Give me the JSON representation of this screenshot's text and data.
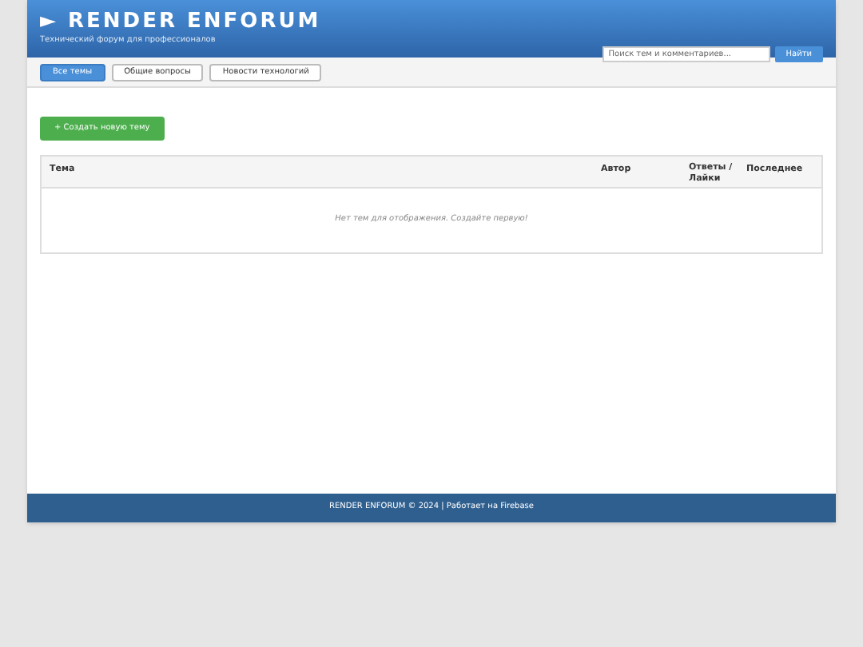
{
  "header": {
    "title": "► RENDER ENFORUM",
    "subtitle": "Технический форум для профессионалов",
    "search": {
      "placeholder": "Поиск тем и комментариев..."
    },
    "search_button": "Найти"
  },
  "tabs": [
    {
      "label": "Все темы",
      "selected": true
    },
    {
      "label": "Общие вопросы",
      "selected": false
    },
    {
      "label": "Новости технологий",
      "selected": false
    }
  ],
  "create_button": "+ Создать новую тему",
  "table": {
    "columns": [
      "Тема",
      "Автор",
      "Ответы / Лайки",
      "Последнее"
    ],
    "empty_message": "Нет тем для отображения. Создайте первую!"
  },
  "footer": "RENDER ENFORUM © 2024 | Работает на Firebase"
}
